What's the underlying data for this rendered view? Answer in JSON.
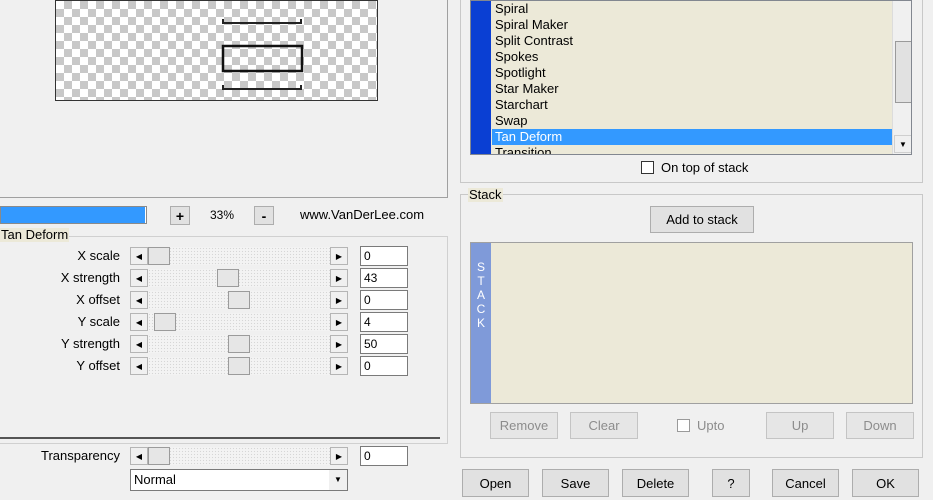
{
  "preview": {
    "zoom_minus_label": "-",
    "zoom_plus_label": "+",
    "zoom_value": "33%",
    "website": "www.VanDerLee.com",
    "progress_fraction": 0.99
  },
  "effect_group": {
    "title": "Tan Deform",
    "sliders": [
      {
        "label": "X scale",
        "value": "0",
        "position": 0.0
      },
      {
        "label": "X strength",
        "value": "43",
        "position": 0.43
      },
      {
        "label": "X offset",
        "value": "0",
        "position": 0.5
      },
      {
        "label": "Y scale",
        "value": "4",
        "position": 0.04
      },
      {
        "label": "Y strength",
        "value": "50",
        "position": 0.5
      },
      {
        "label": "Y offset",
        "value": "0",
        "position": 0.5
      }
    ]
  },
  "transparency": {
    "label": "Transparency",
    "value": "0",
    "position": 0.0,
    "blend_mode": "Normal"
  },
  "effect_list": {
    "items": [
      "Spiral",
      "Spiral Maker",
      "Split Contrast",
      "Spokes",
      "Spotlight",
      "Star Maker",
      "Starchart",
      "Swap",
      "Tan Deform",
      "Transition"
    ],
    "selected_index": 8,
    "on_top_label": "On top of stack"
  },
  "stack": {
    "title": "Stack",
    "add_label": "Add to stack",
    "strip_letters": [
      "S",
      "T",
      "A",
      "C",
      "K"
    ],
    "remove_label": "Remove",
    "clear_label": "Clear",
    "upto_label": "Upto",
    "up_label": "Up",
    "down_label": "Down"
  },
  "bottom_buttons": {
    "open": "Open",
    "save": "Save",
    "delete": "Delete",
    "help": "?",
    "cancel": "Cancel",
    "ok": "OK"
  },
  "colors": {
    "selection": "#3399ff",
    "list_strip": "#0a3fd3",
    "stack_strip": "#7f9ad9",
    "panel_bg": "#ece9d8"
  }
}
